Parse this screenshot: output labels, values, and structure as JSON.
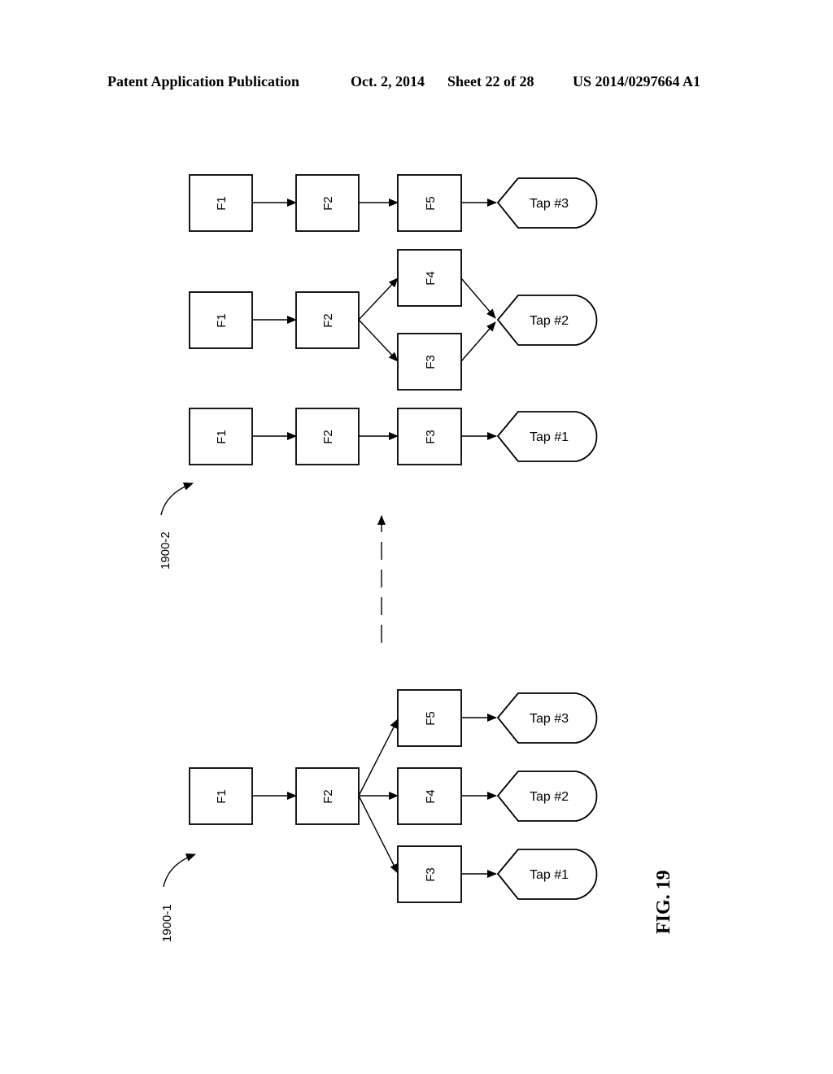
{
  "header": {
    "publication": "Patent Application Publication",
    "date": "Oct. 2, 2014",
    "sheet": "Sheet 22 of 28",
    "number": "US 2014/0297664 A1"
  },
  "figure_label": "FIG. 19",
  "diagrams": [
    {
      "ref": "1900-2",
      "chains": [
        {
          "nodes": [
            "F1",
            "F2",
            "F5"
          ],
          "tap": "Tap #3"
        },
        {
          "nodes": [
            "F1",
            "F2",
            "F4",
            "F3"
          ],
          "tap": "Tap #2"
        },
        {
          "nodes": [
            "F1",
            "F2",
            "F3"
          ],
          "tap": "Tap #1"
        }
      ]
    },
    {
      "ref": "1900-1",
      "nodes": [
        "F1",
        "F2",
        "F5",
        "F4",
        "F3"
      ],
      "taps": [
        "Tap #3",
        "Tap #2",
        "Tap #1"
      ]
    }
  ]
}
